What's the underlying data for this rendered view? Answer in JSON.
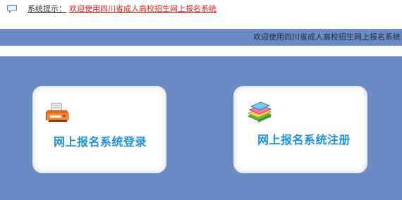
{
  "notice": {
    "icon": "speech-bubble-icon",
    "label": "系统提示：",
    "message": "欢迎使用四川省成人高校招生网上报名系统"
  },
  "header": {
    "marquee": "欢迎使用四川省成人高校招生网上报名系统"
  },
  "cards": {
    "login": {
      "icon": "printer-icon",
      "label": "网上报名系统登录"
    },
    "register": {
      "icon": "books-icon",
      "label": "网上报名系统注册"
    }
  },
  "colors": {
    "band": "#6b8bc4",
    "link_red": "#e0201c",
    "card_label_blue": "#1f8fe0"
  }
}
